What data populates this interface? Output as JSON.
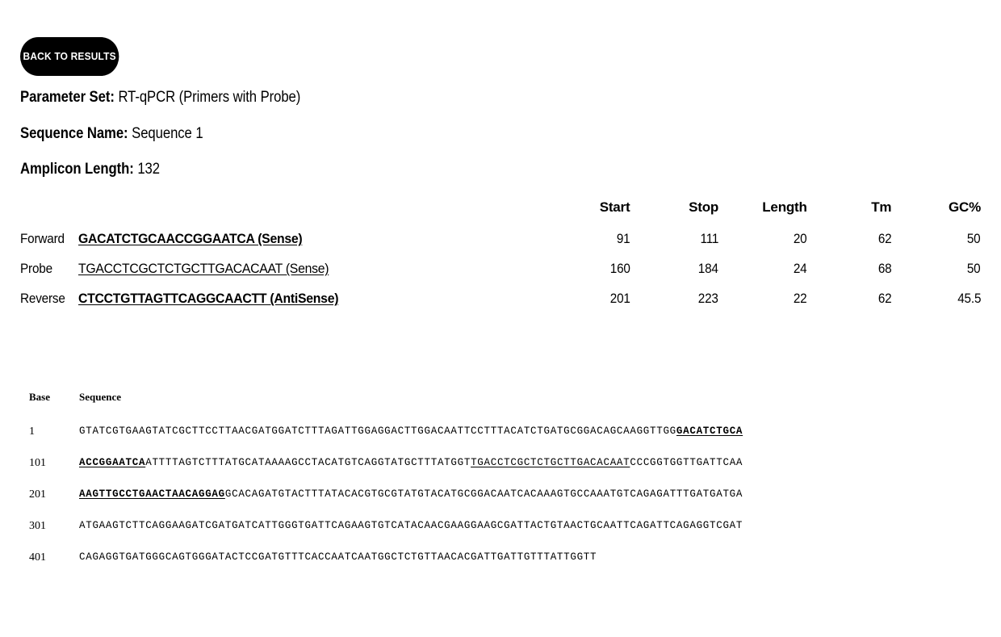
{
  "button": {
    "back_label": "BACK TO RESULTS"
  },
  "meta": {
    "parameter_set_key": "Parameter Set:",
    "parameter_set_value": "RT-qPCR (Primers with Probe)",
    "sequence_name_key": "Sequence Name:",
    "sequence_name_value": "Sequence 1",
    "amplicon_length_key": "Amplicon Length:",
    "amplicon_length_value": "132"
  },
  "primer_table": {
    "headers": {
      "label": "",
      "sequence": "",
      "start": "Start",
      "stop": "Stop",
      "length": "Length",
      "tm": "Tm",
      "gc": "GC%"
    },
    "rows": [
      {
        "label": "Forward",
        "sequence": "GACATCTGCAACCGGAATCA (Sense)",
        "start": "91",
        "stop": "111",
        "length": "20",
        "tm": "62",
        "gc": "50"
      },
      {
        "label": "Probe",
        "sequence": "TGACCTCGCTCTGCTTGACACAAT (Sense)",
        "start": "160",
        "stop": "184",
        "length": "24",
        "tm": "68",
        "gc": "50"
      },
      {
        "label": "Reverse",
        "sequence": "CTCCTGTTAGTTCAGGCAACTT (AntiSense)",
        "start": "201",
        "stop": "223",
        "length": "22",
        "tm": "62",
        "gc": "45.5"
      }
    ]
  },
  "sequence_listing": {
    "header_base": "Base",
    "header_sequence": "Sequence",
    "rows": [
      {
        "base": "1",
        "segments": [
          {
            "text": "GTATCGTGAAGTATCGCTTCCTTAACGATGGATCTTTAGATTGGAGGACTTGGACAATTCCTTTACATCTGATGCGGACAGCAAGGTTGG",
            "style": "plain"
          },
          {
            "text": "GACATCTGCA",
            "style": "primer"
          }
        ]
      },
      {
        "base": "101",
        "segments": [
          {
            "text": "ACCGGAATCA",
            "style": "primer"
          },
          {
            "text": "ATTTTAGTCTTTATGCATAAAAGCCTACATGTCAGGTATGCTTTATGGT",
            "style": "plain"
          },
          {
            "text": "TGACCTCGCTCTGCTTGACACAAT",
            "style": "probe"
          },
          {
            "text": "CCCGGTGGTTGATTCAA",
            "style": "plain"
          }
        ]
      },
      {
        "base": "201",
        "segments": [
          {
            "text": "AAGTTGCCTGAACTAACAGGAG",
            "style": "primer"
          },
          {
            "text": "GCACAGATGTACTTTATACACGTGCGTATGTACATGCGGACAATCACAAAGTGCCAAATGTCAGAGATTTGATGATGA",
            "style": "plain"
          }
        ]
      },
      {
        "base": "301",
        "segments": [
          {
            "text": "ATGAAGTCTTCAGGAAGATCGATGATCATTGGGTGATTCAGAAGTGTCATACAACGAAGGAAGCGATTACTGTAACTGCAATTCAGATTCAGAGGTCGAT",
            "style": "plain"
          }
        ]
      },
      {
        "base": "401",
        "segments": [
          {
            "text": "CAGAGGTGATGGGCAGTGGGATACTCCGATGTTTCACCAATCAATGGCTCTGTTAACACGATTGATTGTTTATTGGTT",
            "style": "plain"
          }
        ]
      }
    ]
  },
  "colors": {
    "background": "#ffffff",
    "text": "#000000",
    "button_bg": "#000000",
    "button_text": "#ffffff"
  }
}
